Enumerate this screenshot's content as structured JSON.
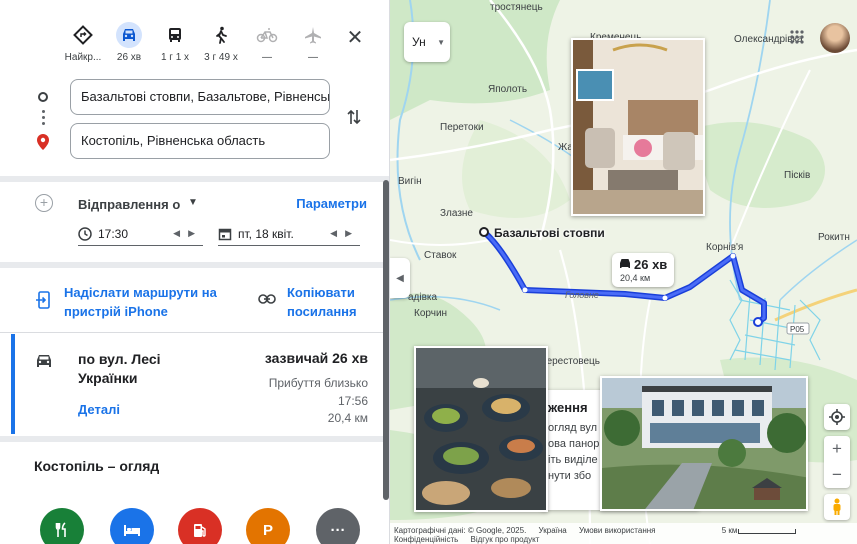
{
  "modes": [
    {
      "name": "best",
      "label": "Найкр...",
      "icon": "directions-diamond-icon",
      "active": false
    },
    {
      "name": "car",
      "label": "26 хв",
      "icon": "car-icon",
      "active": true
    },
    {
      "name": "transit",
      "label": "1 г 1 х",
      "icon": "bus-icon",
      "active": false
    },
    {
      "name": "walk",
      "label": "3 г 49 х",
      "icon": "walk-icon",
      "active": false
    },
    {
      "name": "bike",
      "label": "—",
      "icon": "bike-icon",
      "active": false
    },
    {
      "name": "flight",
      "label": "—",
      "icon": "plane-icon",
      "active": false
    }
  ],
  "route_inputs": {
    "origin": "Базальтові стовпи, Базальтове, Рівненська",
    "destination": "Костопіль, Рівненська область"
  },
  "departure": {
    "label": "Відправлення о",
    "options_link": "Параметри",
    "time": "17:30",
    "date": "пт, 18 квіт."
  },
  "share": {
    "send_label": "Надіслати маршрути на пристрій iPhone",
    "copy_label": "Копіювати посилання"
  },
  "route": {
    "via": "по вул. Лесі Українки",
    "duration": "зазвичай 26 хв",
    "arrival": "Прибуття близько 17:56",
    "distance": "20,4 км",
    "details_link": "Деталі"
  },
  "overview": {
    "title": "Костопіль – огляд",
    "categories": [
      {
        "name": "restaurants",
        "icon": "fork-knife-icon",
        "color": "#188038"
      },
      {
        "name": "hotels",
        "icon": "bed-icon",
        "color": "#1a73e8"
      },
      {
        "name": "gas",
        "icon": "fuel-icon",
        "color": "#d93025"
      },
      {
        "name": "parking",
        "icon": "parking-icon",
        "label": "P",
        "color": "#e37400"
      },
      {
        "name": "more",
        "icon": "more-dots-icon",
        "label": "···",
        "color": "#5f6368"
      }
    ]
  },
  "map": {
    "layer_label": "Ун",
    "route_bubble": {
      "time": "26 хв",
      "distance": "20,4 км"
    },
    "origin_marker_label": "Базальтові стовпи",
    "road_label": "Головне",
    "road_badge": "P05",
    "places": [
      {
        "name": "Кременець",
        "text": "Кременець"
      },
      {
        "name": "Олександрівка",
        "text": "Олександрівка"
      },
      {
        "name": "Яполоть",
        "text": "Яполоть"
      },
      {
        "name": "Перетоки",
        "text": "Перетоки"
      },
      {
        "name": "Жадківка",
        "text": "Жа"
      },
      {
        "name": "Вигін",
        "text": "Вигін"
      },
      {
        "name": "Пісків",
        "text": "Пісків"
      },
      {
        "name": "Злазне",
        "text": "Злазне"
      },
      {
        "name": "Корнів'я",
        "text": "Корнів'я"
      },
      {
        "name": "Рокитне",
        "text": "Рокитн"
      },
      {
        "name": "Ставок",
        "text": "Ставок"
      },
      {
        "name": "Садківка",
        "text": "адівка"
      },
      {
        "name": "Корчин",
        "text": "Корчин"
      },
      {
        "name": "Берестовець",
        "text": "Берестовець"
      },
      {
        "name": "Тростянець",
        "text": "тростянець"
      }
    ],
    "info_card": {
      "heading": "ження",
      "lines": [
        "огляд вул",
        "ова панор",
        "іть виділе",
        "нути збо"
      ]
    },
    "attribution": {
      "data": "Картографічні дані: © Google, 2025.",
      "country": "Україна",
      "terms": "Умови використання",
      "scale": "5 км",
      "privacy": "Конфіденційність",
      "feedback": "Відгук про продукт"
    }
  }
}
